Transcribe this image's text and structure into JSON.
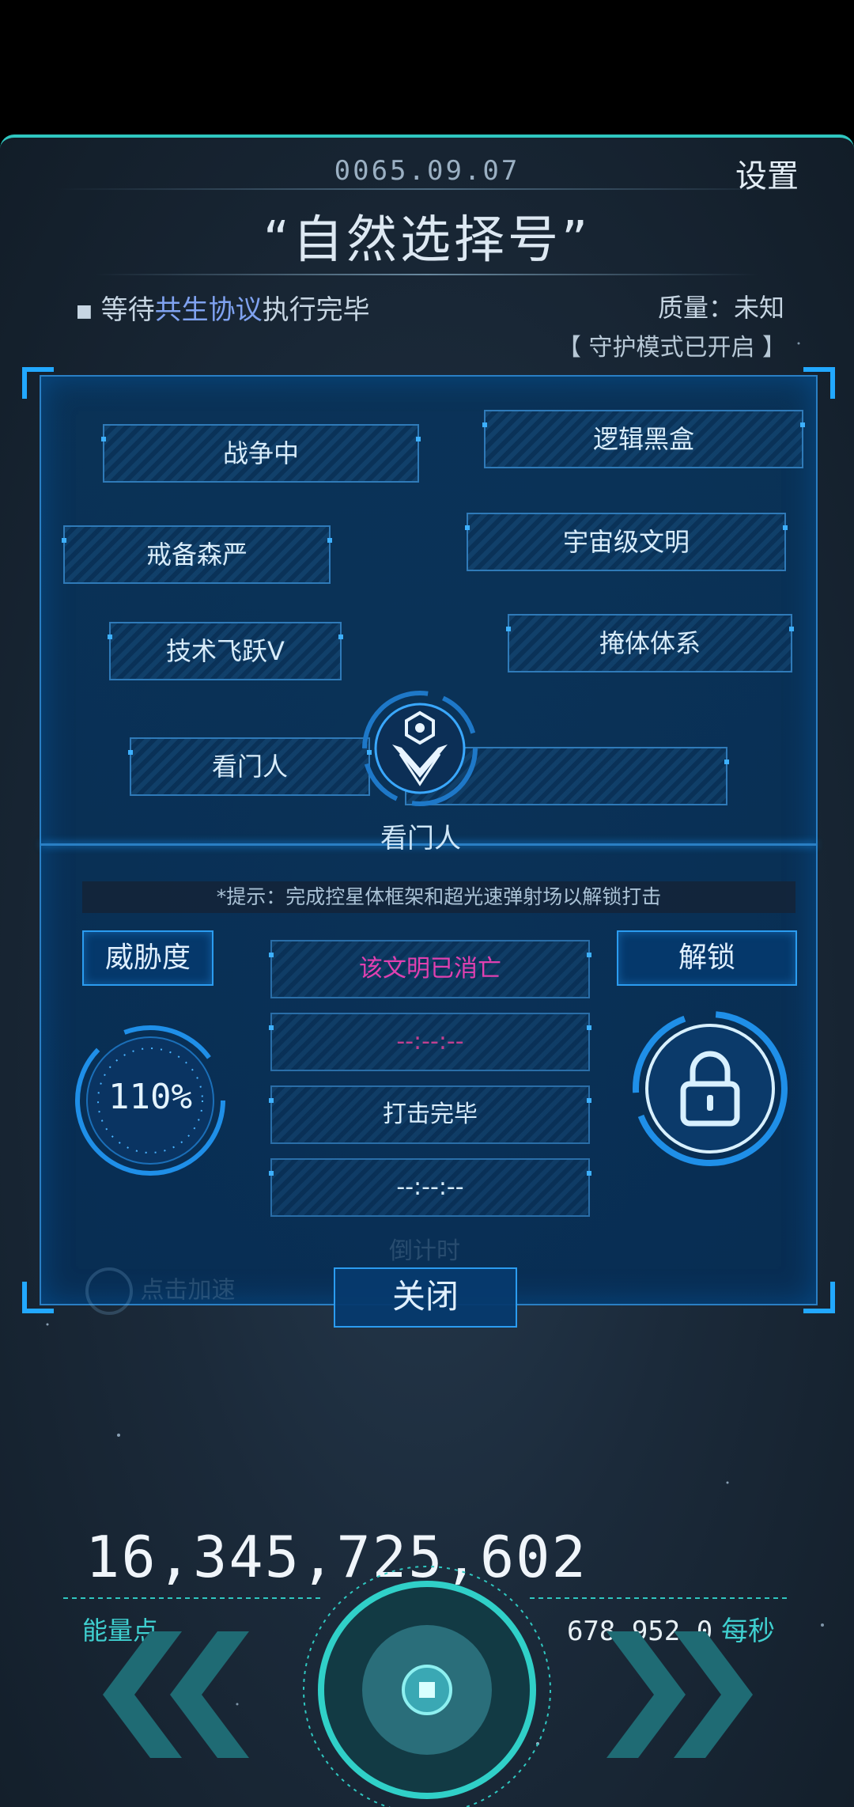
{
  "header": {
    "date": "0065.09.07",
    "settings_label": "设置",
    "ship_name": "“自然选择号”",
    "status_prefix": "等待",
    "status_highlight": "共生协议",
    "status_suffix": "执行完毕",
    "quality": "质量：未知",
    "guard_mode": "【 守护模式已开启 】"
  },
  "tech_tags": [
    "战争中",
    "逻辑黑盒",
    "戒备森严",
    "宇宙级文明",
    "技术飞跃V",
    "掩体体系",
    "看门人",
    ""
  ],
  "emblem": {
    "label": "看门人",
    "icon": "phoenix-emblem-icon"
  },
  "hint": "*提示：完成控星体框架和超光速弹射场以解锁打击",
  "threat": {
    "label": "威胁度",
    "value": "110%"
  },
  "unlock": {
    "label": "解锁",
    "icon": "padlock-icon"
  },
  "slots": [
    {
      "text": "该文明已消亡",
      "color": "#e040b0"
    },
    {
      "text": "--:--:--",
      "color": "#c0408f"
    },
    {
      "text": "打击完毕",
      "color": "#d8ecfa"
    },
    {
      "text": "--:--:--",
      "color": "#d8ecfa"
    }
  ],
  "faded": {
    "countdown": "倒计时",
    "boost": "点击加速"
  },
  "close_label": "关闭",
  "energy": {
    "value": "16,345,725,602",
    "label": "能量点",
    "rate_value": "678,952.0",
    "rate_unit": "每秒"
  },
  "colors": {
    "accent": "#2fc7c0",
    "panel_border": "#2b9cf0",
    "highlight": "#7fa2f0",
    "teal_text": "#3fd0d0"
  }
}
